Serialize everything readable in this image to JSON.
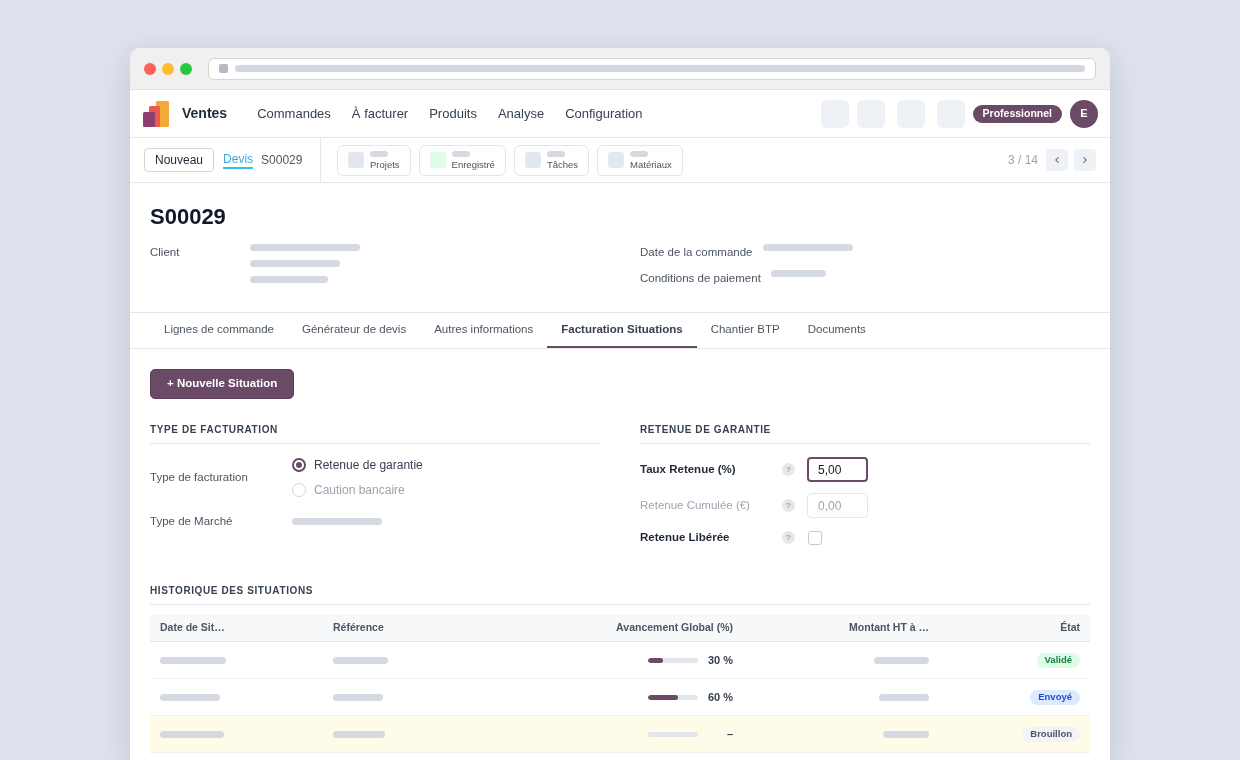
{
  "app": {
    "name": "Ventes",
    "menu": [
      {
        "label": "Commandes"
      },
      {
        "label": "À facturer"
      },
      {
        "label": "Produits"
      },
      {
        "label": "Analyse"
      },
      {
        "label": "Configuration"
      }
    ],
    "plan_badge": "Professionnel",
    "avatar_initial": "E"
  },
  "control_bar": {
    "new_button": "Nouveau",
    "breadcrumb": [
      {
        "label": "Devis",
        "link": true
      },
      {
        "label": "S00029",
        "link": false
      }
    ],
    "smart_buttons": [
      {
        "label": "Projets",
        "color": "#e3e7ee"
      },
      {
        "label": "Enregistré",
        "color": "#dcfce7"
      },
      {
        "label": "Tâches",
        "color": "#e3e7ee"
      },
      {
        "label": "Matériaux",
        "color": "#e3e7ee"
      }
    ],
    "pager": "3 / 14"
  },
  "form": {
    "title": "S00029",
    "left_fields": [
      {
        "label": "Client"
      }
    ],
    "right_fields": [
      {
        "label": "Date de la commande"
      },
      {
        "label": "Conditions de paiement"
      }
    ]
  },
  "tabs": [
    {
      "label": "Lignes de commande",
      "selected": false
    },
    {
      "label": "Générateur de devis",
      "selected": false
    },
    {
      "label": "Autres informations",
      "selected": false
    },
    {
      "label": "Facturation Situations",
      "selected": true
    },
    {
      "label": "Chantier BTP",
      "selected": false
    },
    {
      "label": "Documents",
      "selected": false
    }
  ],
  "new_situation_button": "+ Nouvelle Situation",
  "billing_type": {
    "heading": "TYPE DE FACTURATION",
    "fields": [
      {
        "label": "Type de facturation",
        "kind": "radio",
        "options": [
          {
            "label": "Retenue de garantie",
            "selected": true
          },
          {
            "label": "Caution bancaire",
            "selected": false
          }
        ]
      },
      {
        "label": "Type de Marché",
        "kind": "placeholder"
      }
    ]
  },
  "guarantee": {
    "heading": "RETENUE DE GARANTIE",
    "fields": [
      {
        "label": "Taux Retenue (%)",
        "kind": "input",
        "help": "?",
        "value": "5,00",
        "focused": true,
        "disabled": false
      },
      {
        "label": "Retenue Cumulée (€)",
        "kind": "input",
        "help": "?",
        "value": "0,00",
        "focused": false,
        "disabled": true
      },
      {
        "label": "Retenue Libérée",
        "kind": "checkbox",
        "help": "?",
        "checked": false,
        "disabled": false
      }
    ]
  },
  "history": {
    "heading": "HISTORIQUE DES SITUATIONS",
    "columns": [
      "Date de Sit…",
      "Référence",
      "Avancement Global (%)",
      "Montant HT à …",
      "État"
    ],
    "rows": [
      {
        "level": 0.3,
        "progress": "30 %",
        "status": {
          "label": "Validé",
          "kind": "validated"
        },
        "highlighted": false
      },
      {
        "level": 0.6,
        "progress": "60 %",
        "status": {
          "label": "Envoyé",
          "kind": "sent"
        },
        "highlighted": false
      },
      {
        "progress": "–",
        "status": {
          "label": "Brouillon",
          "kind": "draft"
        },
        "highlighted": true
      }
    ]
  }
}
